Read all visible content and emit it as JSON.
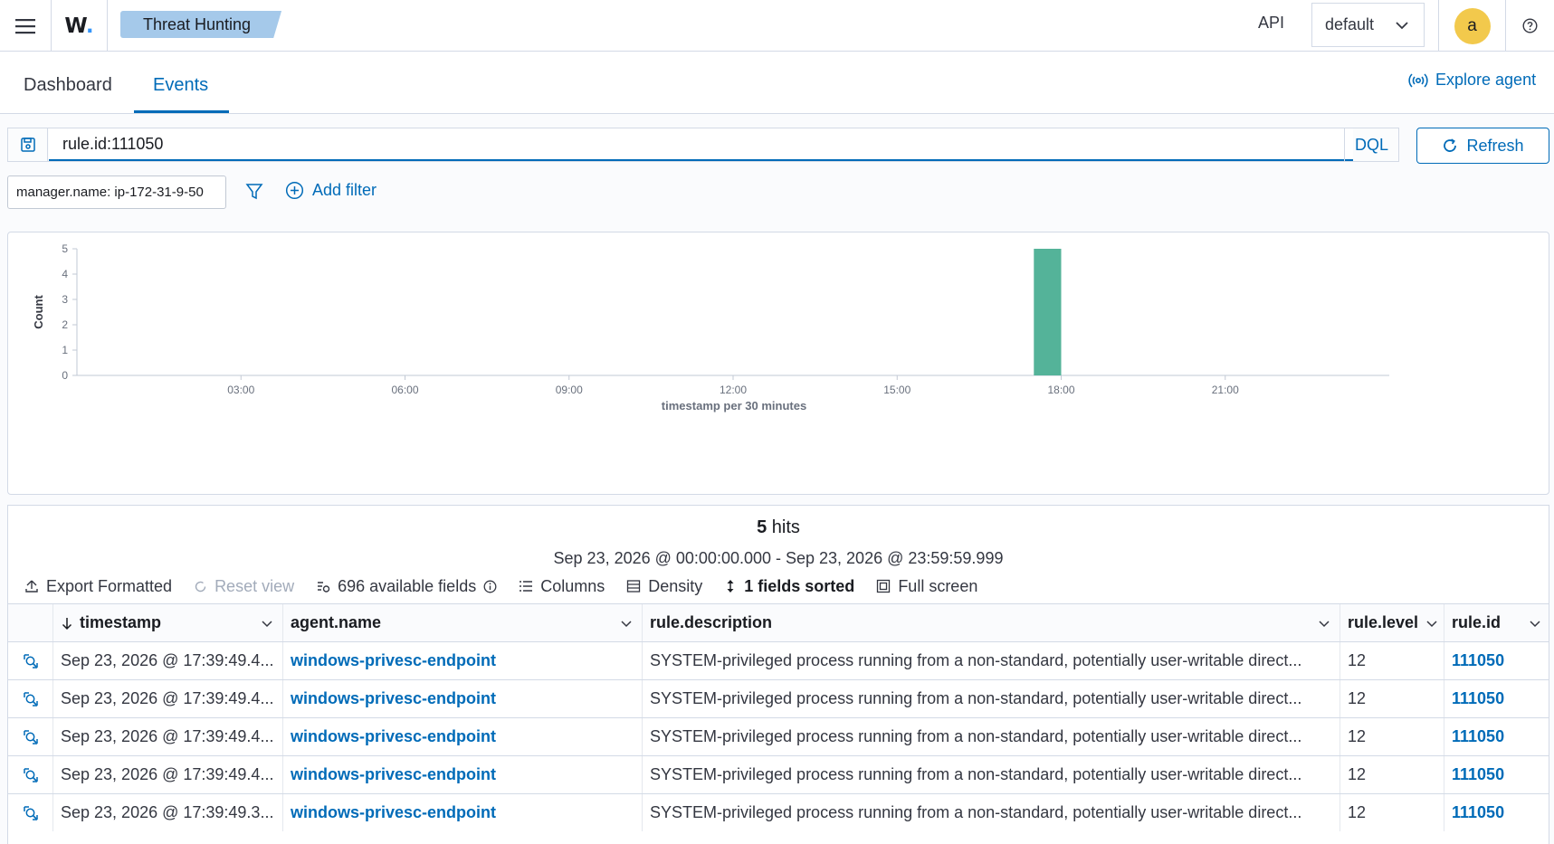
{
  "header": {
    "menu_icon": "hamburger-menu-icon",
    "logo_text": "W",
    "logo_dot": ".",
    "breadcrumb": "Threat Hunting",
    "api_label": "API",
    "space_selected": "default",
    "avatar_letter": "a",
    "help_icon": "help-icon"
  },
  "tabs": {
    "dashboard": "Dashboard",
    "events": "Events",
    "explore_agent": "Explore agent"
  },
  "search": {
    "query": "rule.id:111050",
    "language": "DQL",
    "refresh_label": "Refresh"
  },
  "filters": {
    "pill": "manager.name: ip-172-31-9-50",
    "add_filter_label": "Add filter"
  },
  "chart_data": {
    "type": "bar",
    "x": [
      "17:30"
    ],
    "values": [
      5
    ],
    "xlabel": "timestamp per 30 minutes",
    "ylabel": "Count",
    "ylim": [
      0,
      5
    ],
    "yticks": [
      0,
      1,
      2,
      3,
      4,
      5
    ],
    "xticks": [
      "03:00",
      "06:00",
      "09:00",
      "12:00",
      "15:00",
      "18:00",
      "21:00"
    ],
    "xrange_hours": [
      0,
      24
    ],
    "bar_start_hour": 17.5,
    "bar_width_hours": 0.5,
    "bar_color": "#54b399",
    "grid": false
  },
  "results": {
    "hits_count": "5",
    "hits_label": "hits",
    "date_range": "Sep 23, 2026 @ 00:00:00.000 - Sep 23, 2026 @ 23:59:59.999",
    "toolbar": {
      "export": "Export Formatted",
      "reset": "Reset view",
      "fields": "696 available fields",
      "columns": "Columns",
      "density": "Density",
      "sorted": "1 fields sorted",
      "fullscreen": "Full screen"
    },
    "columns": [
      "timestamp",
      "agent.name",
      "rule.description",
      "rule.level",
      "rule.id"
    ],
    "rows": [
      {
        "timestamp": "Sep 23, 2026 @ 17:39:49.4...",
        "agent": "windows-privesc-endpoint",
        "description": "SYSTEM-privileged process running from a non-standard, potentially user-writable direct...",
        "level": "12",
        "rule_id": "111050"
      },
      {
        "timestamp": "Sep 23, 2026 @ 17:39:49.4...",
        "agent": "windows-privesc-endpoint",
        "description": "SYSTEM-privileged process running from a non-standard, potentially user-writable direct...",
        "level": "12",
        "rule_id": "111050"
      },
      {
        "timestamp": "Sep 23, 2026 @ 17:39:49.4...",
        "agent": "windows-privesc-endpoint",
        "description": "SYSTEM-privileged process running from a non-standard, potentially user-writable direct...",
        "level": "12",
        "rule_id": "111050"
      },
      {
        "timestamp": "Sep 23, 2026 @ 17:39:49.4...",
        "agent": "windows-privesc-endpoint",
        "description": "SYSTEM-privileged process running from a non-standard, potentially user-writable direct...",
        "level": "12",
        "rule_id": "111050"
      },
      {
        "timestamp": "Sep 23, 2026 @ 17:39:49.3...",
        "agent": "windows-privesc-endpoint",
        "description": "SYSTEM-privileged process running from a non-standard, potentially user-writable direct...",
        "level": "12",
        "rule_id": "111050"
      }
    ]
  }
}
